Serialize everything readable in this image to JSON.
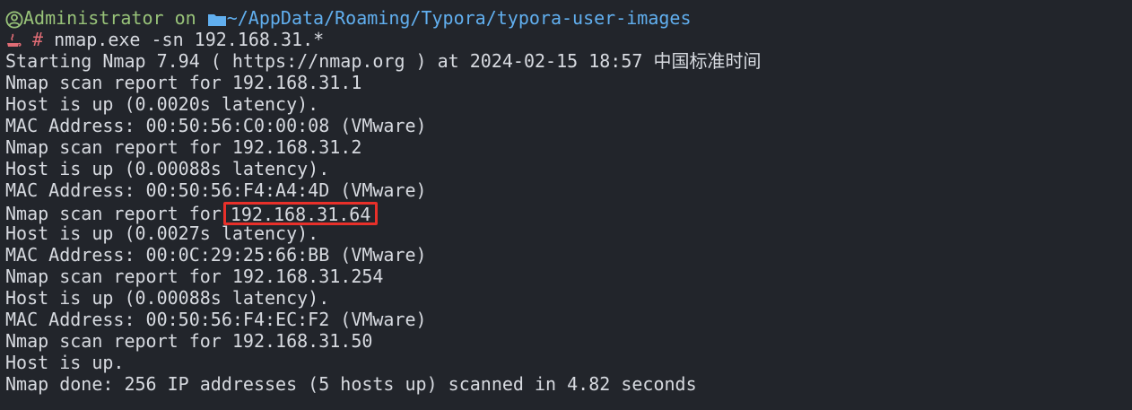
{
  "prompt": {
    "user": "Administrator",
    "on": " on ",
    "path": "~/AppData/Roaming/Typora/typora-user-images",
    "symbol": "#",
    "command": " nmap.exe -sn 192.168.31.*"
  },
  "output": {
    "start": "Starting Nmap 7.94 ( https://nmap.org ) at 2024-02-15 18:57 中国标准时间",
    "hosts": [
      {
        "report_prefix": "Nmap scan report for ",
        "ip": "192.168.31.1",
        "status": "Host is up (0.0020s latency).",
        "mac": "MAC Address: 00:50:56:C0:00:08 (VMware)"
      },
      {
        "report_prefix": "Nmap scan report for ",
        "ip": "192.168.31.2",
        "status": "Host is up (0.00088s latency).",
        "mac": "MAC Address: 00:50:56:F4:A4:4D (VMware)"
      },
      {
        "report_prefix": "Nmap scan report for",
        "ip": "192.168.31.64",
        "status": "Host is up (0.0027s latency).",
        "mac": "MAC Address: 00:0C:29:25:66:BB (VMware)"
      },
      {
        "report_prefix": "Nmap scan report for ",
        "ip": "192.168.31.254",
        "status": "Host is up (0.00088s latency).",
        "mac": "MAC Address: 00:50:56:F4:EC:F2 (VMware)"
      },
      {
        "report_prefix": "Nmap scan report for ",
        "ip": "192.168.31.50",
        "status": "Host is up."
      }
    ],
    "done": "Nmap done: 256 IP addresses (5 hosts up) scanned in 4.82 seconds"
  },
  "colors": {
    "background": "#22252b",
    "text": "#d7dae0",
    "user": "#98c379",
    "path": "#61afef",
    "highlight_border": "#e8302a"
  }
}
